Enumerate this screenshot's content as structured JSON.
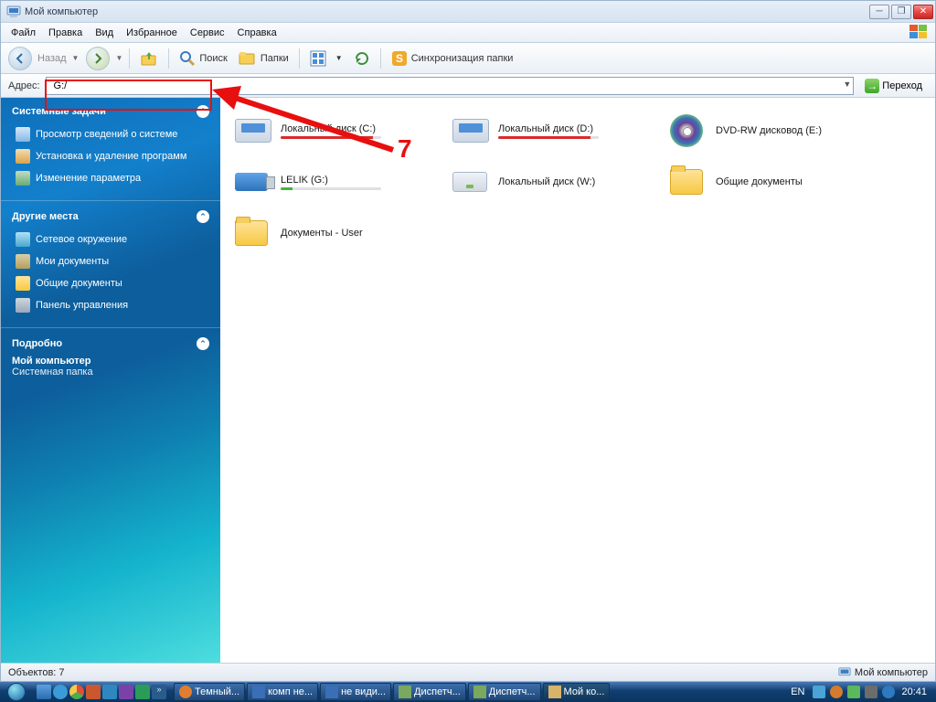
{
  "title": "Мой компьютер",
  "menu": [
    "Файл",
    "Правка",
    "Вид",
    "Избранное",
    "Сервис",
    "Справка"
  ],
  "toolbar": {
    "back": "Назад",
    "search": "Поиск",
    "folders": "Папки",
    "sync": "Синхронизация папки"
  },
  "addressbar": {
    "label": "Адрес:",
    "value": "G:/",
    "go": "Переход"
  },
  "sidebar": {
    "tasks_header": "Системные задачи",
    "tasks": [
      {
        "label": "Просмотр сведений о системе",
        "icon": "si-info"
      },
      {
        "label": "Установка и удаление программ",
        "icon": "si-prog"
      },
      {
        "label": "Изменение параметра",
        "icon": "si-set"
      }
    ],
    "places_header": "Другие места",
    "places": [
      {
        "label": "Сетевое окружение",
        "icon": "si-net"
      },
      {
        "label": "Мои документы",
        "icon": "si-doc"
      },
      {
        "label": "Общие документы",
        "icon": "si-fold"
      },
      {
        "label": "Панель управления",
        "icon": "si-cpl"
      }
    ],
    "details_header": "Подробно",
    "details": {
      "name": "Мой компьютер",
      "type": "Системная папка"
    }
  },
  "drives": [
    {
      "label": "Локальный диск (C:)",
      "icon": "drive",
      "bar": "red"
    },
    {
      "label": "Локальный диск (D:)",
      "icon": "drive",
      "bar": "red"
    },
    {
      "label": "DVD-RW дисковод (E:)",
      "icon": "dvd",
      "bar": null
    },
    {
      "label": "LELIK (G:)",
      "icon": "usb",
      "bar": "green"
    },
    {
      "label": "Локальный диск (W:)",
      "icon": "drive-plain",
      "bar": null
    },
    {
      "label": "Общие документы",
      "icon": "folder",
      "bar": null
    },
    {
      "label": "Документы - User",
      "icon": "folder",
      "bar": null
    }
  ],
  "statusbar": {
    "left": "Объектов: 7",
    "right": "Мой компьютер"
  },
  "annotation": {
    "number": "7"
  },
  "taskbar": {
    "tasks": [
      {
        "label": "Темный...",
        "icon": "#e07d30",
        "active": false
      },
      {
        "label": "комп не...",
        "icon": "#3a6fb7",
        "active": false
      },
      {
        "label": "не види...",
        "icon": "#3a6fb7",
        "active": false
      },
      {
        "label": "Диспетч...",
        "icon": "#7aa85e",
        "active": false
      },
      {
        "label": "Диспетч...",
        "icon": "#7aa85e",
        "active": false
      },
      {
        "label": "Мой ко...",
        "icon": "#d8b46a",
        "active": true
      }
    ],
    "lang": "EN",
    "time": "20:41"
  }
}
